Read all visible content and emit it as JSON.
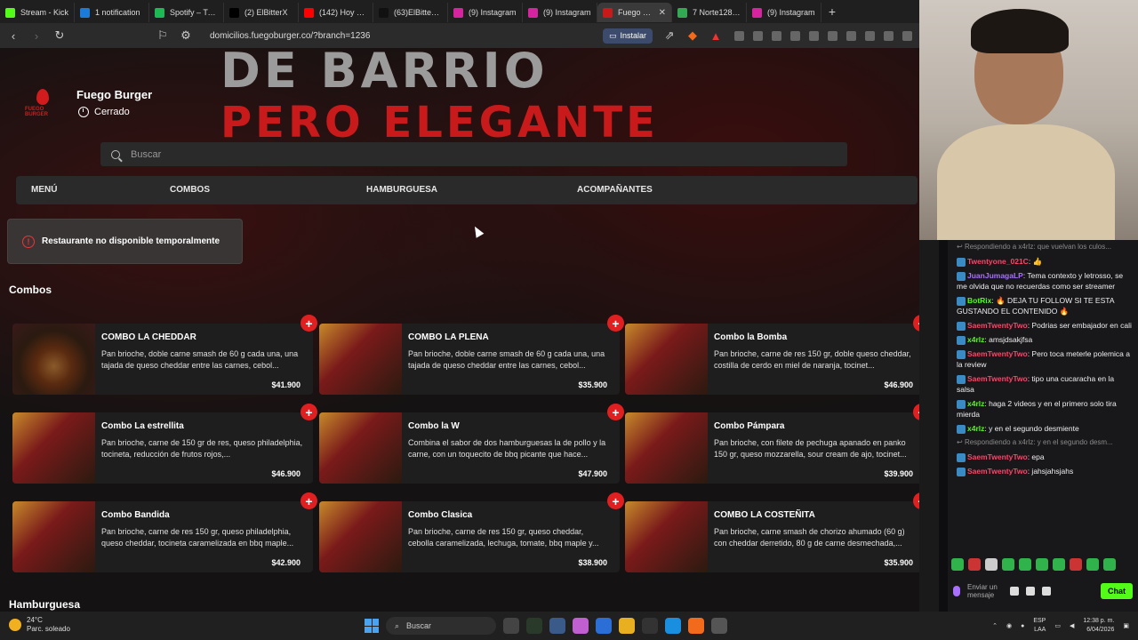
{
  "browser": {
    "tabs": [
      {
        "label": "Stream - Kick",
        "color": "#53fc18"
      },
      {
        "label": "1 notification",
        "color": "#1d7bd8"
      },
      {
        "label": "Spotify – Tus ...",
        "color": "#1db954"
      },
      {
        "label": "(2) ElBitterX",
        "color": "#000000"
      },
      {
        "label": "(142) Hoy doo...",
        "color": "#ff0000"
      },
      {
        "label": "(63)ElBitterX (...",
        "color": "#111111"
      },
      {
        "label": "(9) Instagram",
        "color": "#d6249f"
      },
      {
        "label": "(9) Instagram",
        "color": "#d6249f"
      },
      {
        "label": "Fuego Bur...",
        "color": "#c81a1a",
        "active": true
      },
      {
        "label": "7 Norte128 Ar...",
        "color": "#34a853"
      },
      {
        "label": "(9) Instagram",
        "color": "#d6249f"
      }
    ],
    "url": "domicilios.fuegoburger.co/?branch=1236",
    "install_label": "Instalar",
    "new_tab": "+"
  },
  "hero": {
    "line1": "DE BARRIO",
    "line2": "PERO ELEGANTE"
  },
  "restaurant": {
    "name": "Fuego Burger",
    "status": "Cerrado",
    "logo_text": "FUEGO BURGER"
  },
  "search": {
    "placeholder": "Buscar"
  },
  "nav": {
    "menu": "MENÚ",
    "combos": "COMBOS",
    "hamburguesa": "HAMBURGUESA",
    "acompanantes": "ACOMPAÑANTES"
  },
  "alert": {
    "text": "Restaurante no disponible temporalmente",
    "icon": "!"
  },
  "sections": {
    "combos_title": "Combos",
    "hamburguesa_title": "Hamburguesa"
  },
  "combos": [
    {
      "name": "COMBO LA CHEDDAR",
      "desc": "Pan brioche, doble carne smash de 60 g cada una, una tajada de queso cheddar entre las carnes, cebol...",
      "price": "$41.900"
    },
    {
      "name": "COMBO LA PLENA",
      "desc": "Pan brioche, doble carne smash de 60 g cada una, una tajada de queso cheddar entre las carnes, cebol...",
      "price": "$35.900"
    },
    {
      "name": "Combo la Bomba",
      "desc": "Pan brioche, carne de res 150 gr, doble queso cheddar, costilla de cerdo en miel de naranja, tocinet...",
      "price": "$46.900"
    },
    {
      "name": "Combo La estrellita",
      "desc": "Pan brioche, carne de 150 gr de res, queso philadelphia, tocineta, reducción de frutos rojos,...",
      "price": "$46.900"
    },
    {
      "name": "Combo la W",
      "desc": "Combina el sabor de dos hamburguesas la de pollo y la carne, con un toquecito de bbq picante que hace...",
      "price": "$47.900"
    },
    {
      "name": "Combo Pámpara",
      "desc": "Pan brioche, con filete de pechuga apanado en panko 150 gr, queso mozzarella, sour cream de ajo, tocinet...",
      "price": "$39.900"
    },
    {
      "name": "Combo Bandida",
      "desc": "Pan brioche, carne de res 150 gr, queso philadelphia, queso cheddar, tocineta caramelizada en bbq maple...",
      "price": "$42.900"
    },
    {
      "name": "Combo Clasica",
      "desc": "Pan brioche, carne de res 150 gr, queso cheddar, cebolla caramelizada, lechuga, tomate, bbq maple y...",
      "price": "$38.900"
    },
    {
      "name": "COMBO LA COSTEÑITA",
      "desc": "Pan brioche, carne smash de chorizo ahumado (60 g) con cheddar derretido, 80 g de carne desmechada,...",
      "price": "$35.900"
    }
  ],
  "add_label": "+",
  "chat": {
    "messages": [
      {
        "type": "reply",
        "text": "Respondiendo a x4rlz: que vuelvan los culos..."
      },
      {
        "user": "Twentyone_021C",
        "color": "#ff4466",
        "text": ": 👍"
      },
      {
        "user": "JuanJumagaLP",
        "color": "#a970ff",
        "text": ": Tema contexto y letrosso, se me olvida que no recuerdas como ser streamer"
      },
      {
        "user": "BotRix",
        "color": "#53fc18",
        "text": ": 🔥 DEJA TU FOLLOW SI TE ESTA GUSTANDO EL CONTENIDO 🔥"
      },
      {
        "user": "SaemTwentyTwo",
        "color": "#ff4466",
        "text": ": Podrias ser embajador en cali"
      },
      {
        "user": "x4rlz",
        "color": "#53fc18",
        "text": ": amsjdsakjfsa"
      },
      {
        "user": "SaemTwentyTwo",
        "color": "#ff4466",
        "text": ": Pero toca meterle polemica a la review"
      },
      {
        "user": "SaemTwentyTwo",
        "color": "#ff4466",
        "text": ": tipo una cucaracha en la salsa"
      },
      {
        "user": "x4rlz",
        "color": "#53fc18",
        "text": ": haga 2 videos y en el primero solo tira mierda"
      },
      {
        "user": "x4rlz",
        "color": "#53fc18",
        "text": ": y en el segundo desmiente"
      },
      {
        "type": "reply",
        "text": "Respondiendo a x4rlz: y en el segundo desm..."
      },
      {
        "user": "SaemTwentyTwo",
        "color": "#ff4466",
        "text": ": epa"
      },
      {
        "user": "SaemTwentyTwo",
        "color": "#ff4466",
        "text": ": jahsjahsjahs"
      }
    ],
    "input_placeholder": "Enviar un mensaje",
    "send_label": "Chat"
  },
  "taskbar": {
    "weather_temp": "24°C",
    "weather_desc": "Parc. soleado",
    "search_label": "Buscar",
    "lang": "ESP",
    "lang2": "LAA",
    "time": "12:38 p. m.",
    "date": "6/04/2026"
  }
}
